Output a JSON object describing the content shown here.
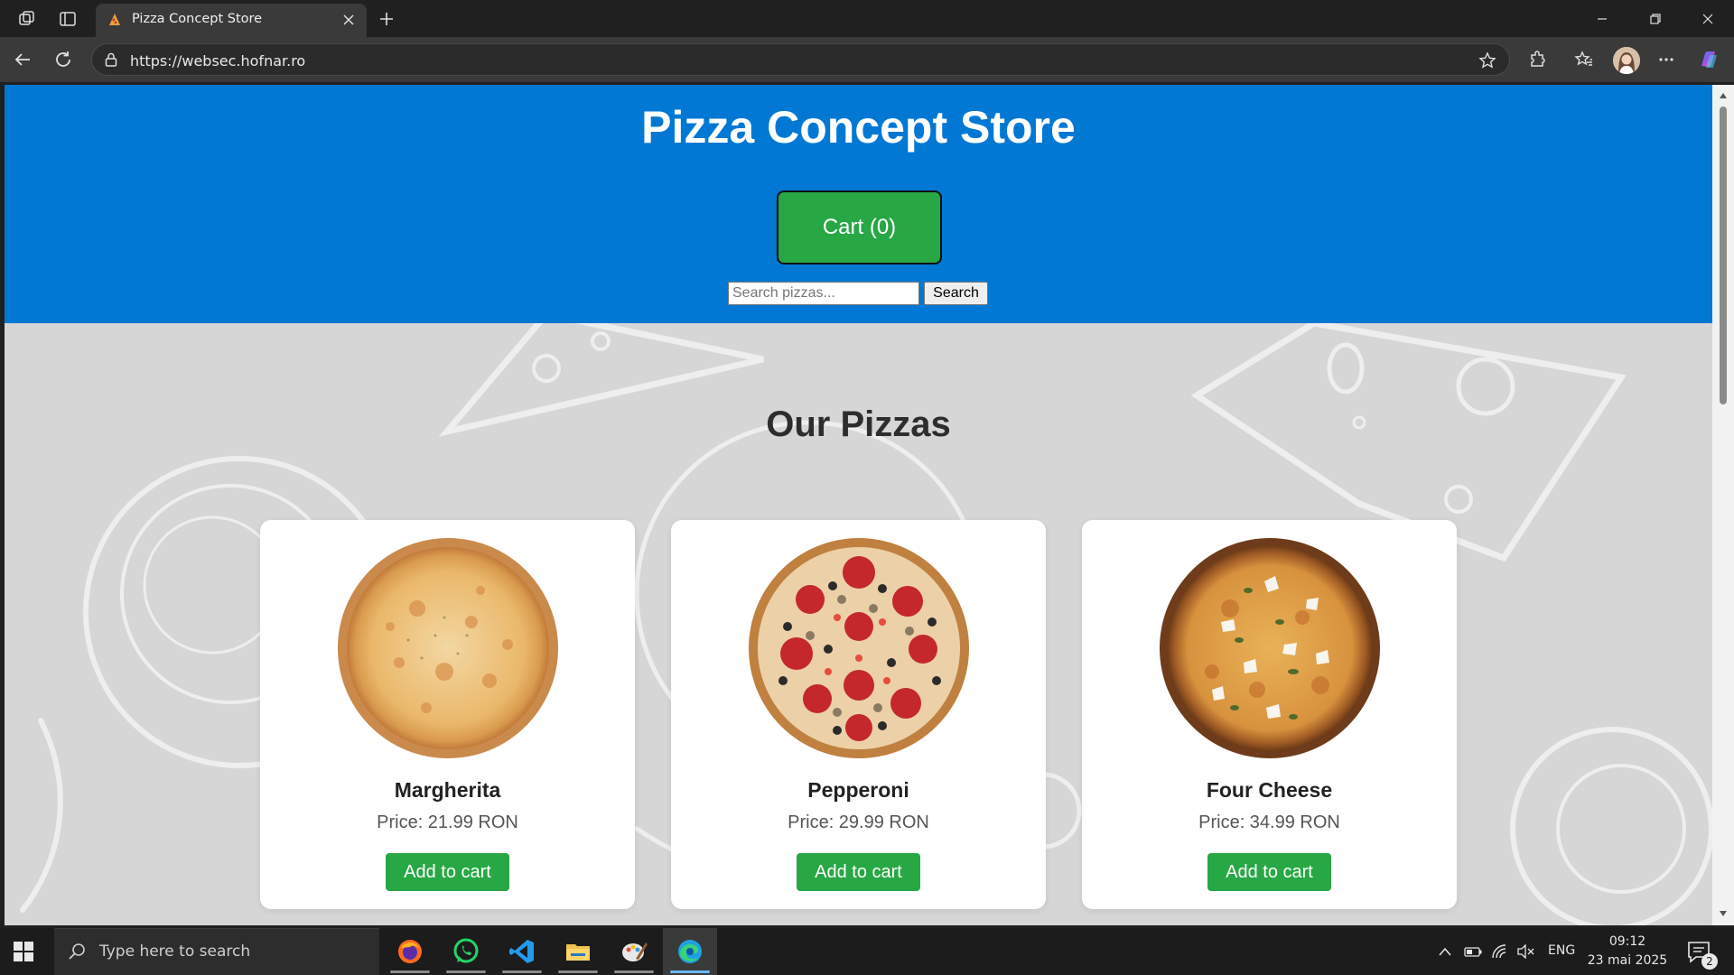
{
  "browser": {
    "tab_title": "Pizza Concept Store",
    "url": "https://websec.hofnar.ro"
  },
  "page": {
    "store_title": "Pizza Concept Store",
    "cart_label": "Cart (0)",
    "search_placeholder": "Search pizzas...",
    "search_value": "",
    "search_button": "Search",
    "section_title": "Our Pizzas",
    "pizzas": [
      {
        "name": "Margherita",
        "price": "Price: 21.99 RON",
        "button": "Add to cart"
      },
      {
        "name": "Pepperoni",
        "price": "Price: 29.99 RON",
        "button": "Add to cart"
      },
      {
        "name": "Four Cheese",
        "price": "Price: 34.99 RON",
        "button": "Add to cart"
      }
    ]
  },
  "taskbar": {
    "search_text": "Type here to search",
    "apps": [
      "firefox-icon",
      "whatsapp-icon",
      "vscode-icon",
      "file-explorer-icon",
      "paint-icon",
      "edge-icon"
    ],
    "language": "ENG",
    "time": "09:12",
    "date": "23 mai 2025",
    "notification_count": "2"
  },
  "colors": {
    "header_blue": "#0078d4",
    "button_green": "#28a745",
    "page_bg": "#d6d6d6"
  }
}
